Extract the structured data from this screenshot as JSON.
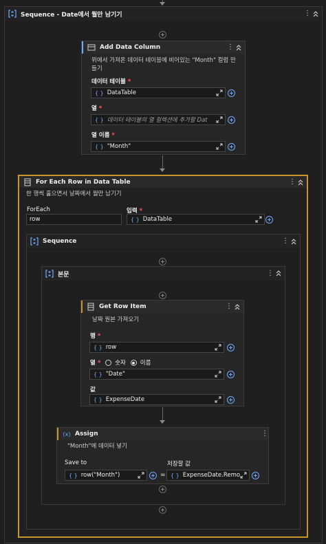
{
  "outer_sequence": {
    "title": "Sequence - Date에서 월만 남기기",
    "icon": "sequence-icon"
  },
  "add_data_column": {
    "title": "Add Data Column",
    "icon": "table-column-icon",
    "description": "위에서 가져온 데이터 테이블에 비어있는 \"Month\" 컬럼 만들기",
    "fields": [
      {
        "label": "데이터 테이블",
        "value": "DataTable"
      },
      {
        "label": "열",
        "placeholder": "데이터 테이블의 열 컬렉션에 추가할 Dat"
      },
      {
        "label": "열 이름",
        "value": "\"Month\""
      }
    ]
  },
  "for_each_row": {
    "title": "For Each Row in Data Table",
    "icon": "for-each-icon",
    "description": "한 행씩 훑으면서 날짜에서 월만 남기기",
    "foreach_label": "ForEach",
    "foreach_value": "row",
    "input_label": "입력",
    "input_value": "DataTable"
  },
  "inner_sequence": {
    "title": "Sequence",
    "icon": "sequence-icon"
  },
  "body": {
    "title": "본문",
    "icon": "sequence-icon"
  },
  "get_row_item": {
    "title": "Get Row Item",
    "icon": "table-icon",
    "description": "날짜 원본 가져오기",
    "row_label": "행",
    "row_value": "row",
    "column_label": "열",
    "radio_number": "숫자",
    "radio_name": "이름",
    "selected_radio": "이름",
    "column_value": "\"Date\"",
    "value_label": "값",
    "value_value": "ExpenseDate"
  },
  "assign": {
    "title": "Assign",
    "icon": "assign-icon",
    "description": "\"Month\"에 데이터 넣기",
    "save_to_label": "Save to",
    "save_to_value": "row(\"Month\")",
    "equals": "=",
    "value_label": "저장할 값",
    "value_value": "ExpenseDate.Remove("
  },
  "colors": {
    "background": "#1e1e1e",
    "selection_border": "#c8962a",
    "accent": "#6fa8ff",
    "required": "#ff5b5b"
  }
}
